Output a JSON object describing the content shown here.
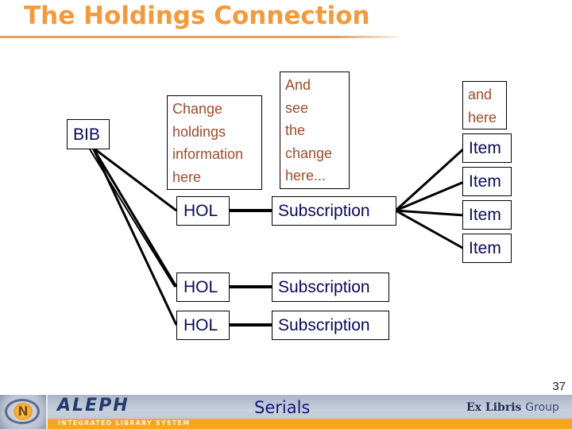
{
  "header": {
    "title": "The Holdings Connection"
  },
  "diagram": {
    "bib": "BIB",
    "holdings": [
      {
        "label": "HOL",
        "subscription": "Subscription"
      },
      {
        "label": "HOL",
        "subscription": "Subscription"
      },
      {
        "label": "HOL",
        "subscription": "Subscription"
      }
    ],
    "items": [
      "Item",
      "Item",
      "Item",
      "Item"
    ],
    "notes": {
      "holdings_note": [
        "Change",
        "holdings",
        "information",
        "here"
      ],
      "subscription_note": [
        "And",
        "see",
        "the",
        "change",
        "here..."
      ],
      "items_note": [
        "and",
        "here"
      ]
    },
    "colors": {
      "title": "#f39a3c",
      "node_text": "#0a0a5c",
      "note_text": "#a04a2a"
    }
  },
  "footer": {
    "page_number": "37",
    "product": "ALEPH",
    "product_tagline": "INTEGRATED LIBRARY SYSTEM",
    "section": "Serials",
    "company": "Ex Libris",
    "company_suffix": "Group",
    "logo_glyph": "N"
  }
}
